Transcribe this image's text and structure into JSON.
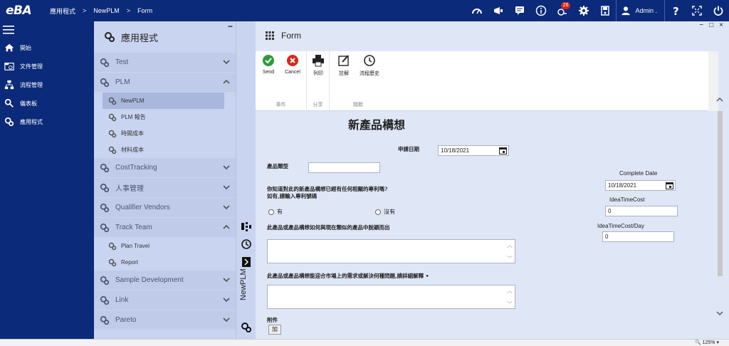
{
  "topbar": {
    "logo": "eBA",
    "breadcrumb": [
      "應用程式",
      "NewPLM",
      "Form"
    ],
    "separator": ">",
    "notification_count": "26",
    "user_name": "Admin ."
  },
  "leftnav": {
    "items": [
      {
        "label": "開始",
        "icon": "home-icon"
      },
      {
        "label": "文件管理",
        "icon": "document-icon"
      },
      {
        "label": "流程管理",
        "icon": "flow-icon"
      },
      {
        "label": "儀表板",
        "icon": "dashboard-icon"
      },
      {
        "label": "應用程式",
        "icon": "apps-icon"
      }
    ]
  },
  "apppanel": {
    "title": "應用程式",
    "collapse": "−",
    "groups": [
      {
        "label": "Test",
        "expanded": false,
        "subs": []
      },
      {
        "label": "PLM",
        "expanded": true,
        "subs": [
          "NewPLM",
          "PLM 報告",
          "時間成本",
          "材料成本"
        ]
      },
      {
        "label": "CostTracking",
        "expanded": false,
        "subs": []
      },
      {
        "label": "人事管理",
        "expanded": false,
        "subs": []
      },
      {
        "label": "Qualifier Vendors",
        "expanded": false,
        "subs": []
      },
      {
        "label": "Track Team",
        "expanded": true,
        "subs": [
          "Plan Travel",
          "Report"
        ]
      },
      {
        "label": "Sample Development",
        "expanded": false,
        "subs": []
      },
      {
        "label": "Link",
        "expanded": false,
        "subs": []
      },
      {
        "label": "Pareto",
        "expanded": false,
        "subs": []
      }
    ]
  },
  "vstrip": {
    "label": "NewPLM"
  },
  "formwin": {
    "title": "Form",
    "controls": [
      "−",
      "□",
      "×"
    ],
    "toolbar": {
      "groups": [
        {
          "label": "事件",
          "buttons": [
            "Send",
            "Cancel"
          ]
        },
        {
          "label": "分享",
          "buttons": [
            "列印"
          ]
        },
        {
          "label": "閱歎",
          "buttons": [
            "註解",
            "流程歷史"
          ]
        }
      ]
    }
  },
  "form": {
    "title": "新產品構想",
    "apply_date_label": "申請日期",
    "apply_date_value": "10/18/2021",
    "product_type_label": "產品類型",
    "product_type_value": "",
    "patent_q_line1": "你知道對此的新產品構想已經有任何相關的專利嗎?",
    "patent_q_line2": "如有,請輸入專利號碼",
    "radio_yes": "有",
    "radio_no": "沒有",
    "compare_label": "此產品或產品構想如何與現在類似的產品中脫穎而出",
    "need_label": "此產品或產品構想能迎合市場上的需求或解決何種問題,請詳細解釋 •",
    "attachment_label": "附件",
    "add_button": "加",
    "complete_date_label": "Complete Date",
    "complete_date_value": "10/18/2021",
    "idea_time_cost_label": "IdeaTimeCost",
    "idea_time_cost_value": "0",
    "idea_time_cost_day_label": "IdeaTimeCost/Day",
    "idea_time_cost_day_value": "0"
  },
  "statusbar": {
    "zoom": "125%"
  }
}
